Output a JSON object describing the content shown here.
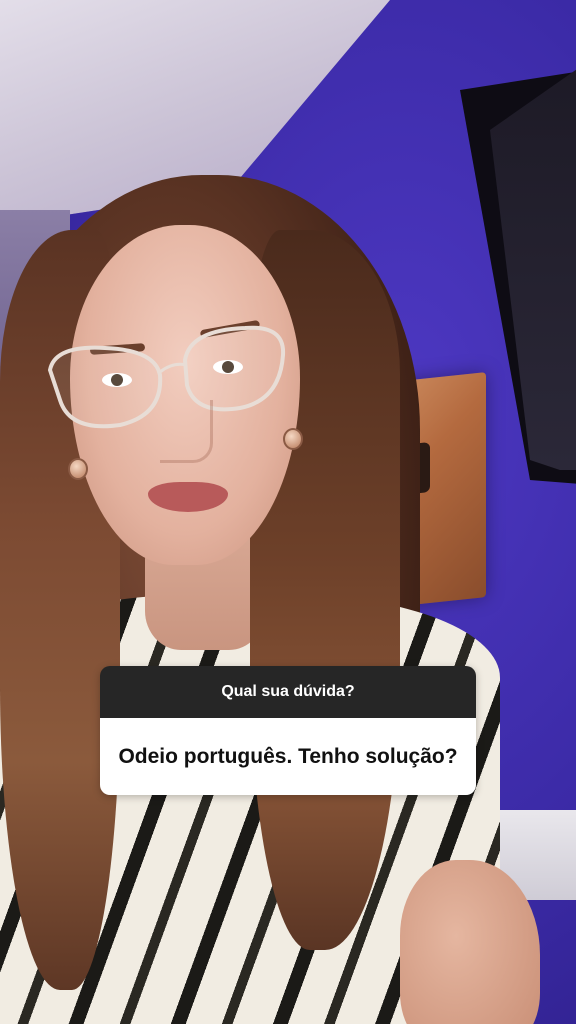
{
  "question_sticker": {
    "prompt": "Qual sua dúvida?",
    "answer": "Odeio português. Tenho solução?"
  },
  "colors": {
    "wall": "#3b2aa6",
    "sticker_header": "#262626",
    "sticker_body": "#ffffff"
  }
}
